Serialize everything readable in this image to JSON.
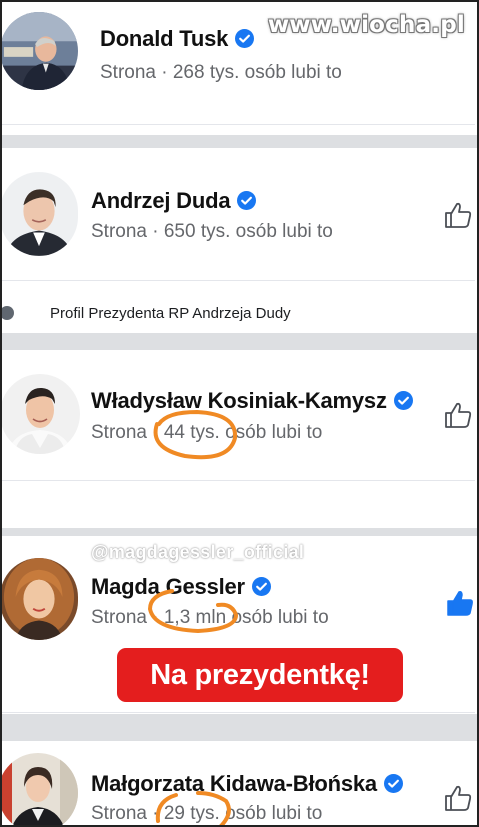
{
  "watermark": "www.wiocha.pl",
  "pages": [
    {
      "name": "Donald Tusk",
      "meta": "Strona · 268 tys. osób lubi to",
      "liked": false
    },
    {
      "name": "Andrzej Duda",
      "meta": "Strona · 650 tys. osób lubi to",
      "liked": false,
      "subtitle": "Profil Prezydenta RP Andrzeja Dudy"
    },
    {
      "name": "Władysław Kosiniak-Kamysz",
      "meta": "Strona · 44 tys. osób lubi to",
      "liked": false
    },
    {
      "name": "Magda Gessler",
      "meta": "Strona · 1,3 mln osób lubi to",
      "liked": true,
      "handle": "@magdagessler_official"
    },
    {
      "name": "Małgorzata Kidawa-Błońska",
      "meta": "Strona · 29 tys. osób lubi to",
      "liked": false
    }
  ],
  "banner": "Na prezydentkę!",
  "colors": {
    "verified": "#1877f2",
    "liked": "#1877f2",
    "banner": "#e41e1e",
    "annotation": "#f08a24",
    "separator": "#dddfe2"
  },
  "icons": [
    "verified-badge-icon",
    "like-thumb-icon",
    "info-icon"
  ]
}
